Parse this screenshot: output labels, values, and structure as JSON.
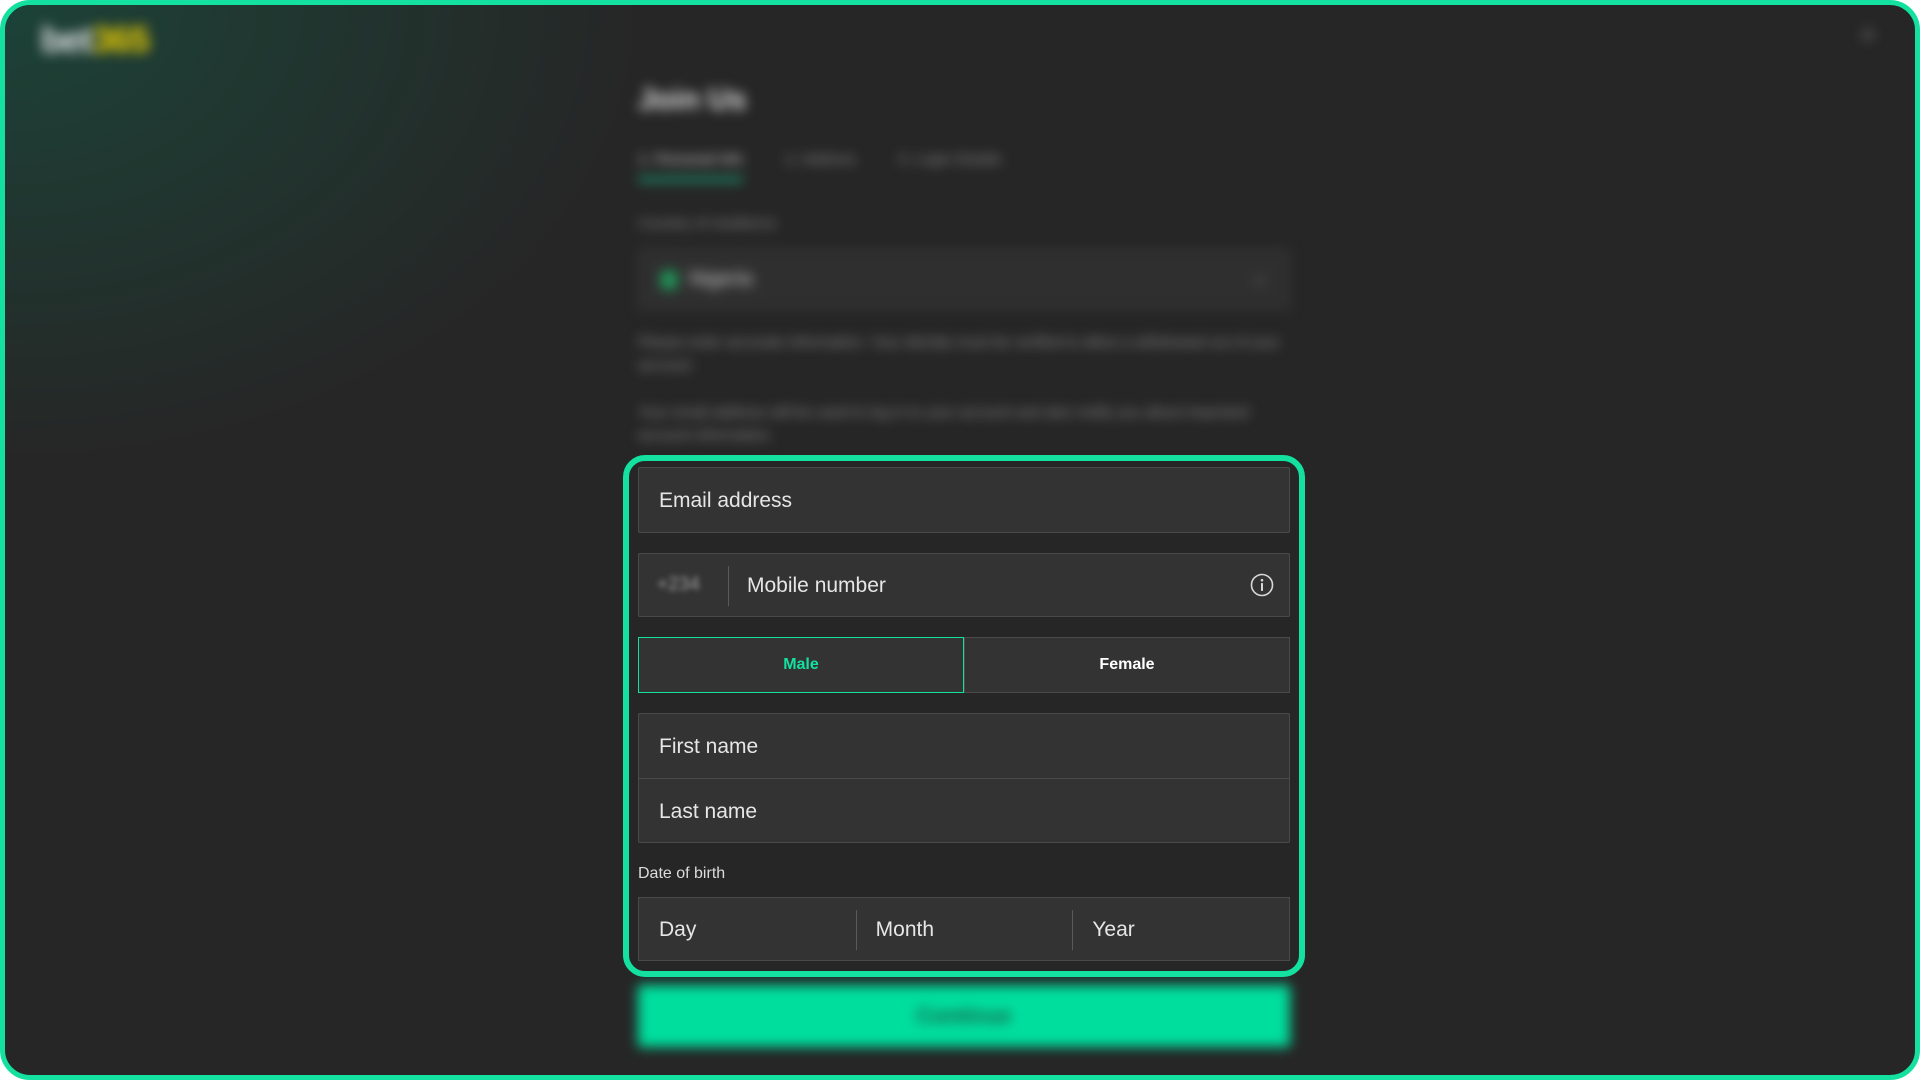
{
  "brand": {
    "part_a": "bet",
    "part_b": "365"
  },
  "page": {
    "title": "Join Us",
    "steps": [
      "1. Personal Info",
      "2. Address",
      "3. Login Details"
    ],
    "country_label": "Country of residence",
    "country_value": "Nigeria",
    "info_paragraph_1": "Please enter accurate information. Your identity must be verified to allow a withdrawal out of your account.",
    "info_paragraph_2": "Your email address will be used to log in to your account and also notify you about important account information.",
    "continue_label": "Continue"
  },
  "form": {
    "email_placeholder": "Email address",
    "dial_code": "+234",
    "mobile_placeholder": "Mobile number",
    "gender": {
      "male_label": "Male",
      "female_label": "Female",
      "selected": "Male"
    },
    "first_name_placeholder": "First name",
    "last_name_placeholder": "Last name",
    "dob_label": "Date of birth",
    "dob_day": "Day",
    "dob_month": "Month",
    "dob_year": "Year"
  },
  "colors": {
    "accent": "#14e0a0",
    "background": "#262626",
    "field": "#333333",
    "brand_yellow": "#f5d400"
  },
  "icons": {
    "info": "info-icon",
    "close": "close-icon",
    "chevron": "chevron-down-icon"
  }
}
